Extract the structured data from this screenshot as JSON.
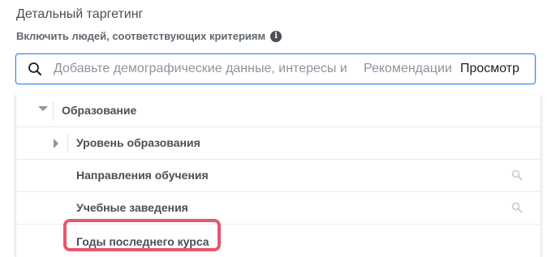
{
  "section": {
    "title": "Детальный таргетинг",
    "subtitle": "Включить людей, соответствующих критериям",
    "info_icon": "info-icon"
  },
  "search": {
    "placeholder": "Добавьте демографические данные, интересы и",
    "recommendations_label": "Рекомендации",
    "browse_label": "Просмотр",
    "icon": "search-icon"
  },
  "tree": {
    "category": {
      "label": "Образование",
      "icon": "caret-down-icon"
    },
    "items": [
      {
        "label": "Уровень образования",
        "icon": "caret-right-icon"
      },
      {
        "label": "Направления обучения",
        "icon": "search-icon"
      },
      {
        "label": "Учебные заведения",
        "icon": "search-icon"
      },
      {
        "label": "Годы последнего курса"
      }
    ]
  },
  "colors": {
    "input_border": "#4080ff",
    "highlight": "#e8566e",
    "text": "#4b4f56",
    "muted": "#8d949e"
  }
}
